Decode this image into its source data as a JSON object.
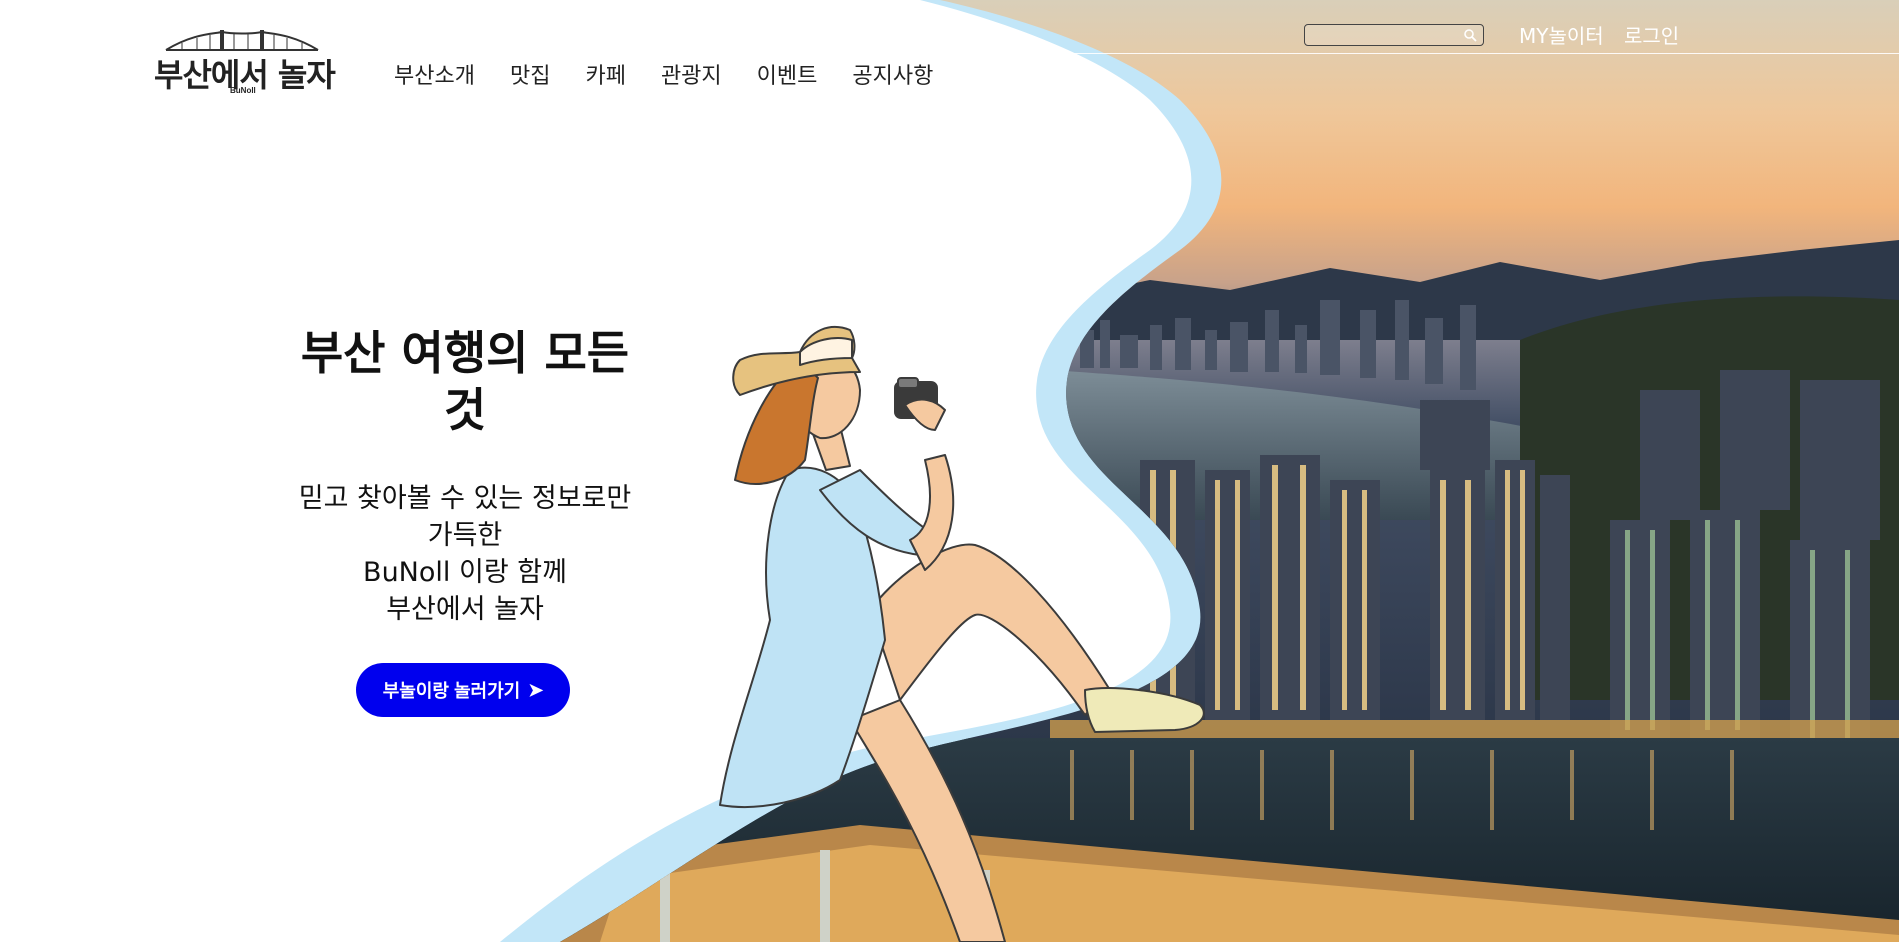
{
  "header": {
    "logo_text": "부산에서 놀자",
    "logo_sub": "BuNoll",
    "nav": [
      "부산소개",
      "맛집",
      "카페",
      "관광지",
      "이벤트",
      "공지사항"
    ],
    "search": {
      "placeholder": "",
      "value": ""
    },
    "my_link": "MY놀이터",
    "login_link": "로그인"
  },
  "hero": {
    "title_line1": "부산 여행의 모든",
    "title_line2": "것",
    "desc": [
      "믿고 찾아볼 수 있는 정보로만",
      "가득한",
      "BuNoll 이랑 함께",
      "부산에서 놀자"
    ],
    "cta_label": "부놀이랑 놀러가기",
    "cta_arrow": "➤"
  },
  "colors": {
    "cta": "#0000ee",
    "wave": "#c2e6f8",
    "dress": "#bfe3f5",
    "skin": "#f5c9a0",
    "hair": "#c9762e",
    "hat": "#e6c27f"
  },
  "icons": {
    "search": "search-icon"
  }
}
